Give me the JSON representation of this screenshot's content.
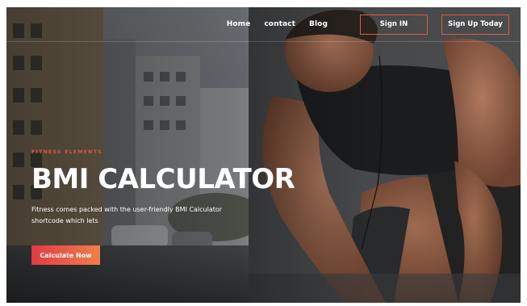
{
  "nav": {
    "links": [
      {
        "label": "Home"
      },
      {
        "label": "contact"
      },
      {
        "label": "Blog"
      }
    ],
    "signin_label": "Sign IN",
    "signup_label": "Sign Up Today"
  },
  "hero": {
    "eyebrow": "FITNESS ELEMENTS",
    "title": "BMI CALCULATOR",
    "description": "Fitness comes packed with the user-friendly BMI Calculator shortcode which lets",
    "cta_label": "Calculate Now"
  },
  "colors": {
    "accent": "#e25a3a",
    "cta_gradient_start": "#e23a45",
    "cta_gradient_end": "#f07f4a",
    "text": "#ffffff"
  }
}
